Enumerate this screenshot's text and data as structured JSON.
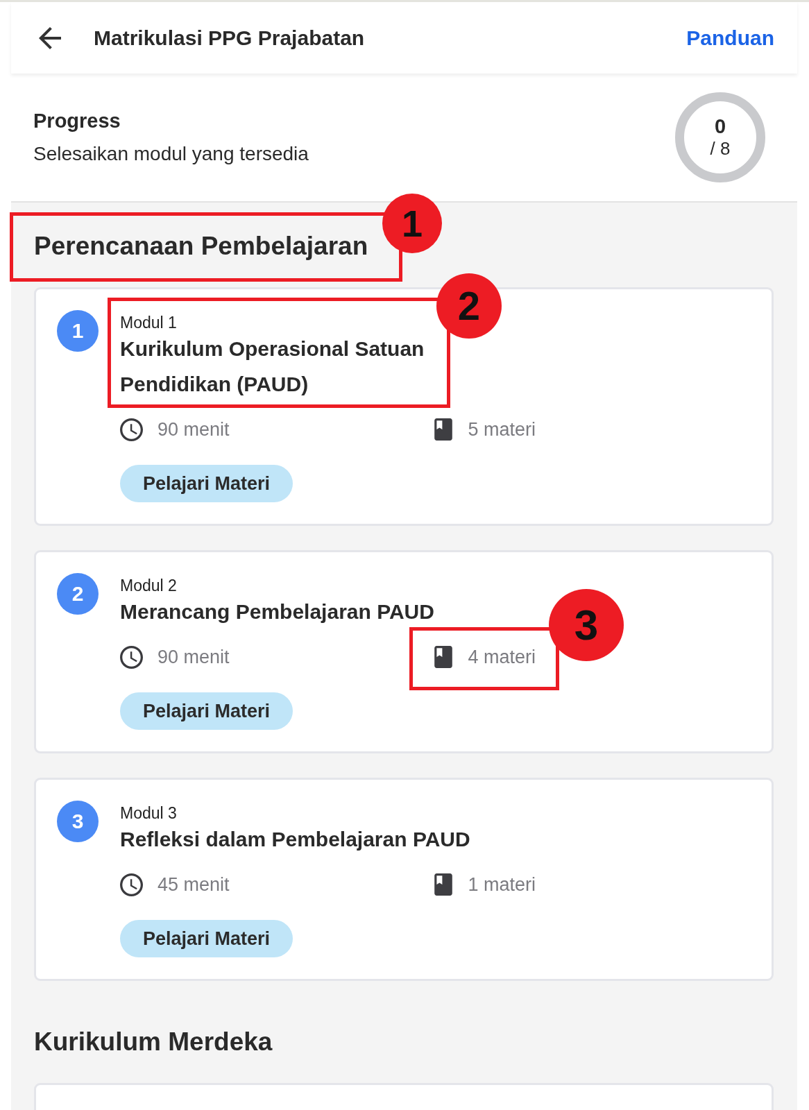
{
  "header": {
    "title": "Matrikulasi PPG Prajabatan",
    "guide_link": "Panduan"
  },
  "progress": {
    "title": "Progress",
    "subtitle": "Selesaikan modul yang tersedia",
    "done": "0",
    "total": "/ 8"
  },
  "sections": [
    {
      "title": "Perencanaan Pembelajaran",
      "callout": "1",
      "modules": [
        {
          "number": "1",
          "label": "Modul 1",
          "title": "Kurikulum Operasional Satuan Pendidikan (PAUD)",
          "duration": "90 menit",
          "materials": "5 materi",
          "button": "Pelajari Materi",
          "heading_callout": "2"
        },
        {
          "number": "2",
          "label": "Modul 2",
          "title": "Merancang Pembelajaran PAUD",
          "duration": "90 menit",
          "materials": "4 materi",
          "button": "Pelajari Materi",
          "materials_callout": "3"
        },
        {
          "number": "3",
          "label": "Modul 3",
          "title": "Refleksi dalam Pembelajaran PAUD",
          "duration": "45 menit",
          "materials": "1 materi",
          "button": "Pelajari Materi"
        }
      ]
    },
    {
      "title": "Kurikulum Merdeka",
      "more_cards_below": true
    }
  ]
}
